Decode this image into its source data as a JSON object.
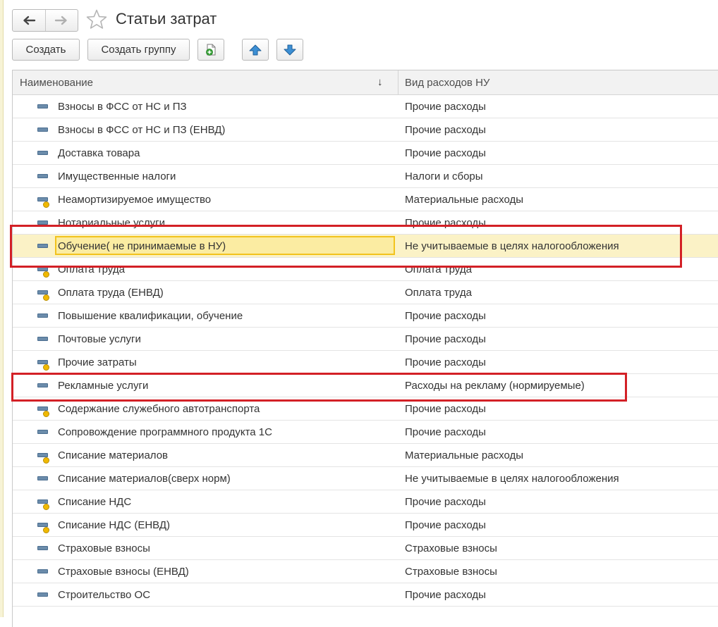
{
  "window": {
    "title": "Статьи затрат"
  },
  "toolbar": {
    "create_label": "Создать",
    "create_group_label": "Создать группу",
    "copy_icon": "copy-icon",
    "up_icon": "arrow-up-icon",
    "down_icon": "arrow-down-icon"
  },
  "table": {
    "headers": {
      "name": "Наименование",
      "expense_type": "Вид расходов НУ",
      "sort_indicator": "↓"
    },
    "rows": [
      {
        "name": "Взносы в ФСС от НС и ПЗ",
        "type": "Прочие расходы",
        "mark": false,
        "selected": false
      },
      {
        "name": "Взносы в ФСС от НС и ПЗ (ЕНВД)",
        "type": "Прочие расходы",
        "mark": false,
        "selected": false
      },
      {
        "name": "Доставка товара",
        "type": "Прочие расходы",
        "mark": false,
        "selected": false
      },
      {
        "name": "Имущественные налоги",
        "type": "Налоги и сборы",
        "mark": false,
        "selected": false
      },
      {
        "name": "Неамортизируемое имущество",
        "type": "Материальные расходы",
        "mark": true,
        "selected": false
      },
      {
        "name": "Нотариальные услуги",
        "type": "Прочие расходы",
        "mark": false,
        "selected": false
      },
      {
        "name": "Обучение( не принимаемые в НУ)",
        "type": "Не учитываемые в целях налогообложения",
        "mark": false,
        "selected": true
      },
      {
        "name": "Оплата труда",
        "type": "Оплата труда",
        "mark": true,
        "selected": false
      },
      {
        "name": "Оплата труда (ЕНВД)",
        "type": "Оплата труда",
        "mark": true,
        "selected": false
      },
      {
        "name": "Повышение квалификации, обучение",
        "type": "Прочие расходы",
        "mark": false,
        "selected": false
      },
      {
        "name": "Почтовые услуги",
        "type": "Прочие расходы",
        "mark": false,
        "selected": false
      },
      {
        "name": "Прочие затраты",
        "type": "Прочие расходы",
        "mark": true,
        "selected": false
      },
      {
        "name": "Рекламные услуги",
        "type": "Расходы на рекламу (нормируемые)",
        "mark": false,
        "selected": false
      },
      {
        "name": "Содержание служебного автотранспорта",
        "type": "Прочие расходы",
        "mark": true,
        "selected": false
      },
      {
        "name": "Сопровождение программного продукта 1С",
        "type": "Прочие расходы",
        "mark": false,
        "selected": false
      },
      {
        "name": "Списание материалов",
        "type": "Материальные расходы",
        "mark": true,
        "selected": false
      },
      {
        "name": "Списание материалов(сверх норм)",
        "type": "Не учитываемые в целях налогообложения",
        "mark": false,
        "selected": false
      },
      {
        "name": "Списание НДС",
        "type": "Прочие расходы",
        "mark": true,
        "selected": false
      },
      {
        "name": "Списание НДС (ЕНВД)",
        "type": "Прочие расходы",
        "mark": true,
        "selected": false
      },
      {
        "name": "Страховые взносы",
        "type": "Страховые взносы",
        "mark": false,
        "selected": false
      },
      {
        "name": "Страховые взносы (ЕНВД)",
        "type": "Страховые взносы",
        "mark": false,
        "selected": false
      },
      {
        "name": "Строительство ОС",
        "type": "Прочие расходы",
        "mark": false,
        "selected": false
      }
    ]
  },
  "annotations": {
    "highlight_color": "#d32026"
  },
  "colors": {
    "selected_row": "#fbf2c6",
    "selected_cell_border": "#f2c31d",
    "item_icon": "#6b8cab",
    "mark_dot": "#f0b900"
  }
}
